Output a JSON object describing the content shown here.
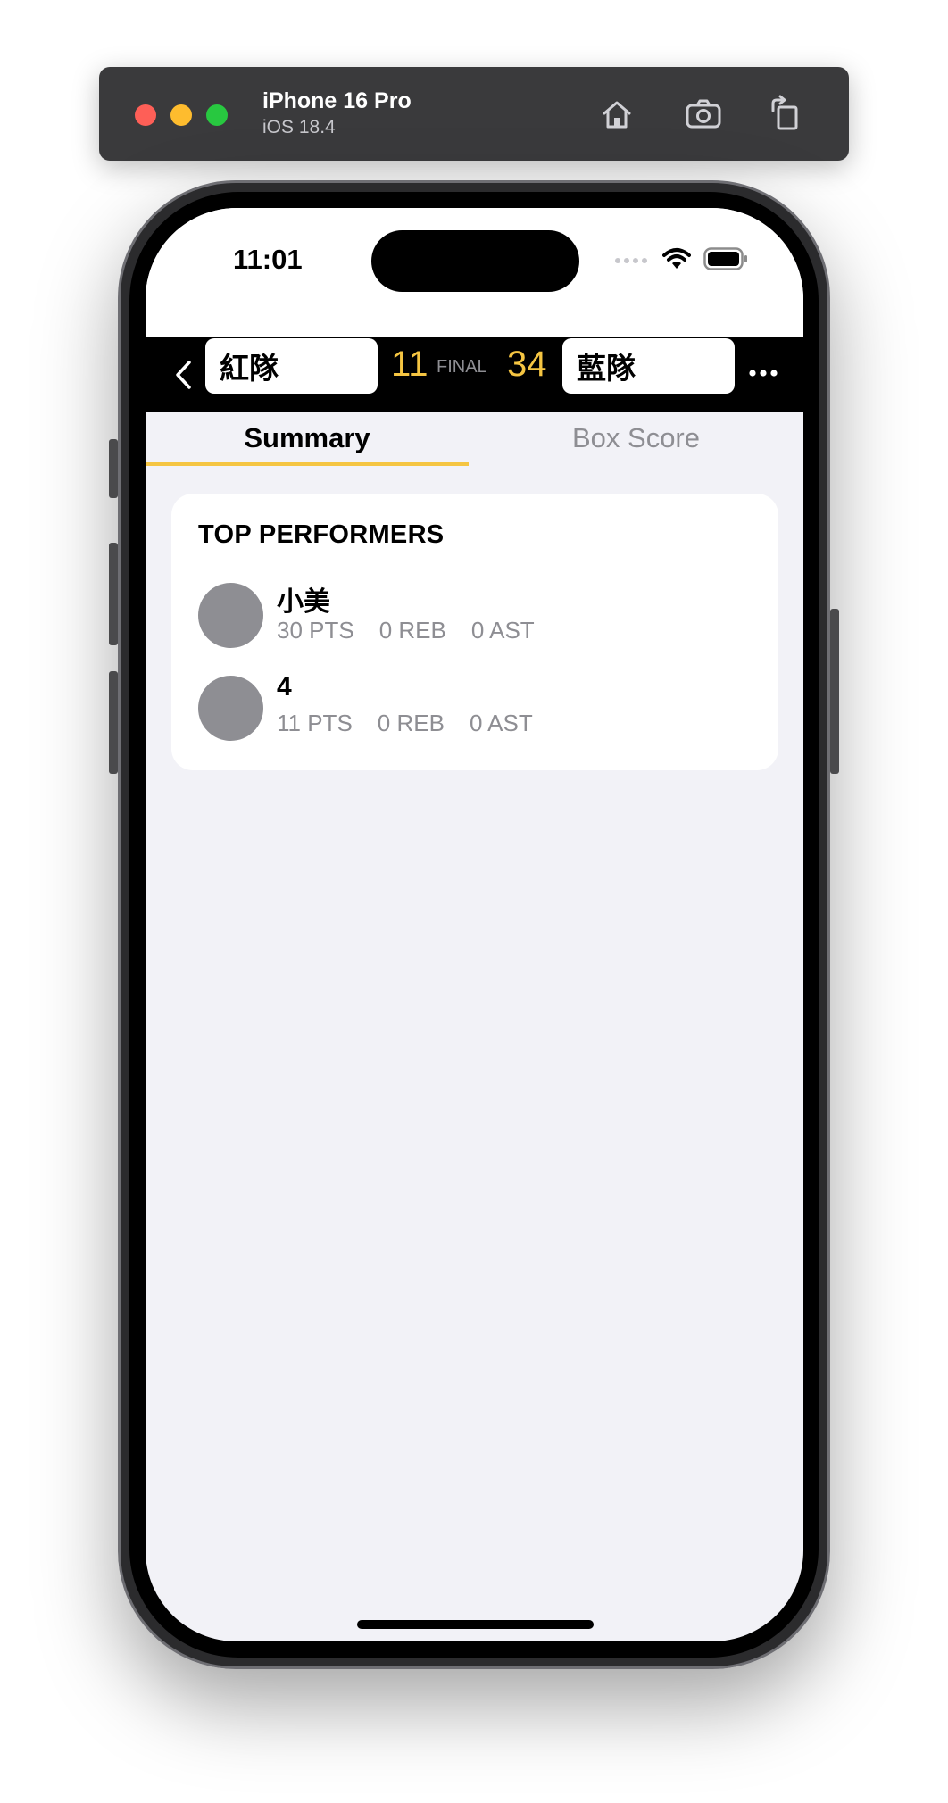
{
  "simulator": {
    "device_name": "iPhone 16 Pro",
    "os_version": "iOS 18.4",
    "buttons": [
      "home-icon",
      "screenshot-icon",
      "rotate-icon"
    ]
  },
  "status_bar": {
    "time": "11:01"
  },
  "game_header": {
    "home_team": "紅隊",
    "home_score": "11",
    "status": "FINAL",
    "away_score": "34",
    "away_team": "藍隊"
  },
  "tabs": [
    {
      "label": "Summary",
      "selected": true
    },
    {
      "label": "Box Score",
      "selected": false
    }
  ],
  "top_performers": {
    "title": "TOP PERFORMERS",
    "players": [
      {
        "name": "小美",
        "pts": "30 PTS",
        "reb": "0 REB",
        "ast": "0 AST"
      },
      {
        "name": "4",
        "pts": "11 PTS",
        "reb": "0 REB",
        "ast": "0 AST"
      }
    ]
  },
  "colors": {
    "accent": "#f5c542",
    "header_bg": "#000000",
    "screen_bg": "#f2f2f7",
    "avatar": "#8e8e93"
  }
}
